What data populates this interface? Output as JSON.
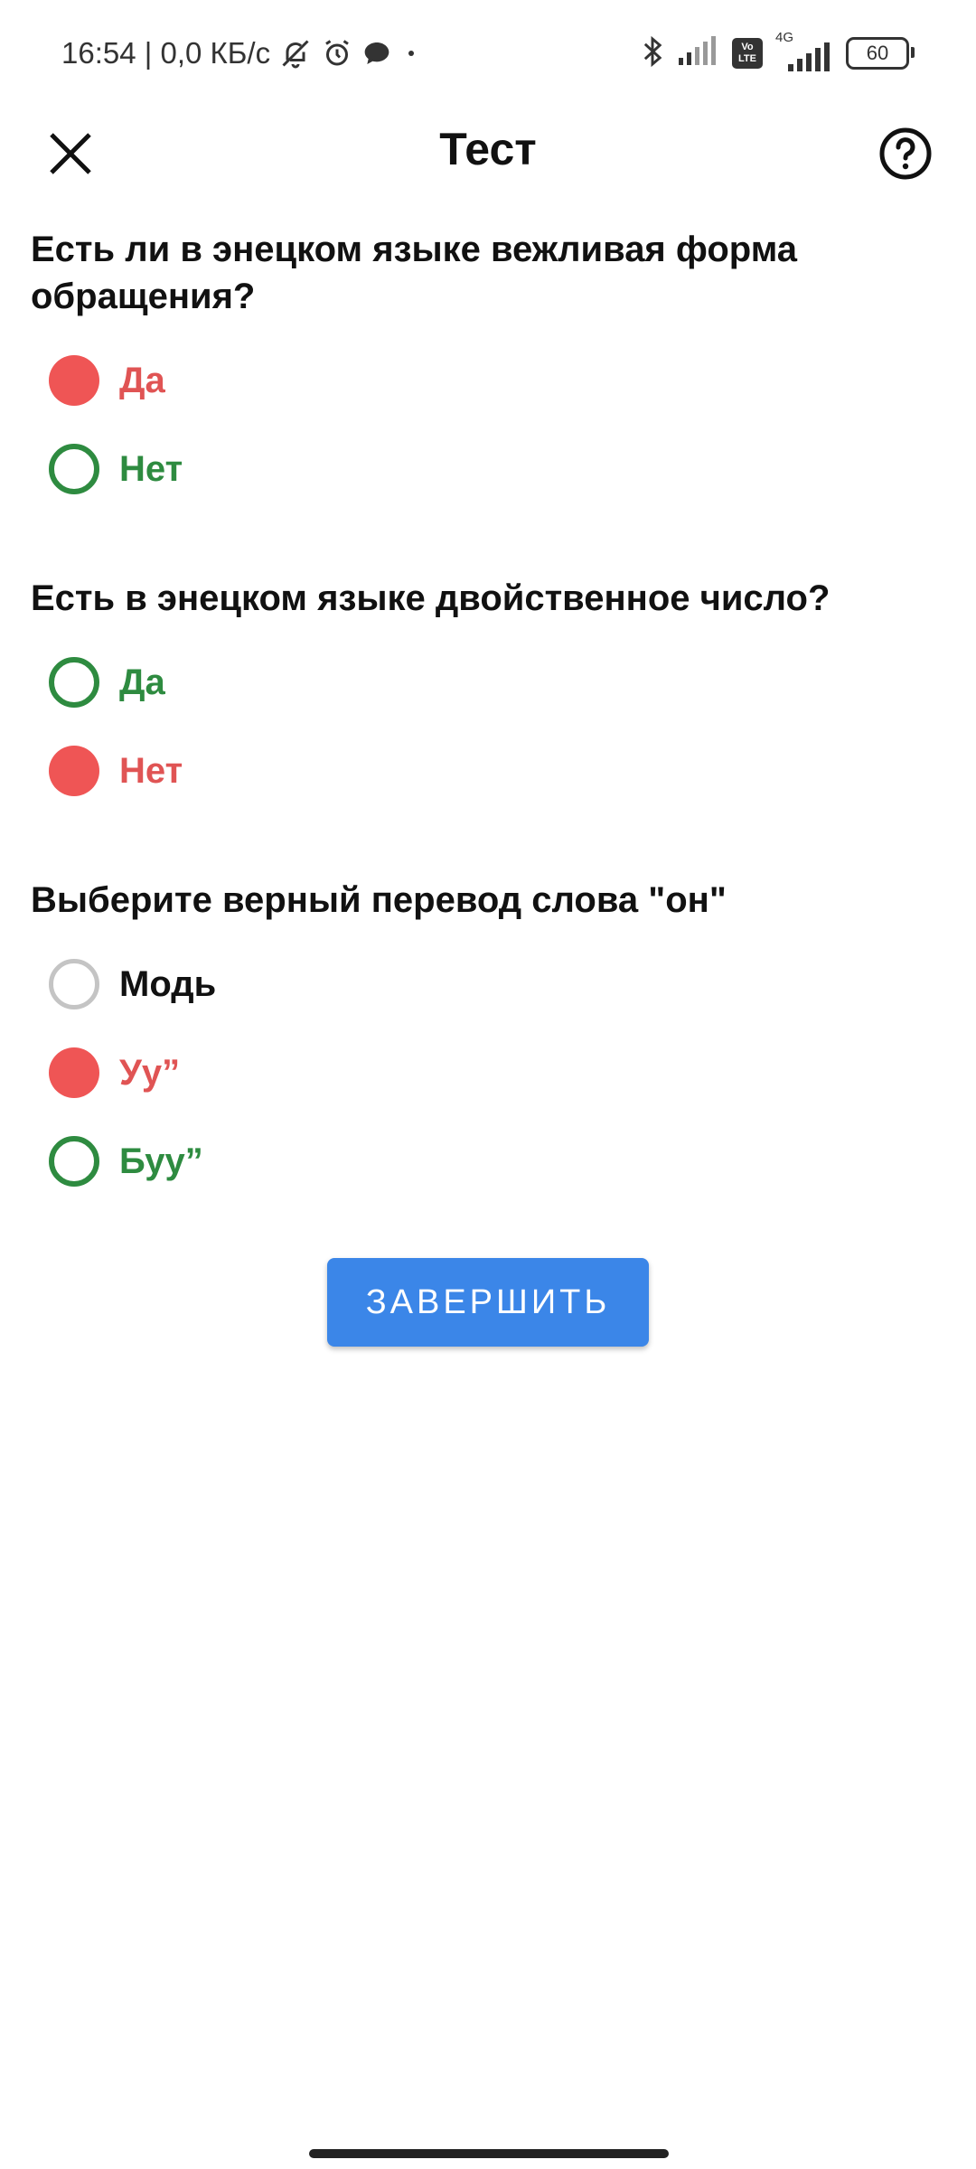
{
  "status_bar": {
    "time_speed": "16:54 | 0,0 КБ/с",
    "network_type": "4G",
    "volte": "Vo LTE",
    "battery": "60"
  },
  "header": {
    "title": "Тест"
  },
  "questions": [
    {
      "text": "Есть ли в энецком языке вежливая форма обращения?",
      "options": [
        {
          "label": "Да",
          "state": "wrong"
        },
        {
          "label": "Нет",
          "state": "correct"
        }
      ]
    },
    {
      "text": "Есть в энецком языке двойственное число?",
      "options": [
        {
          "label": "Да",
          "state": "correct"
        },
        {
          "label": "Нет",
          "state": "wrong"
        }
      ]
    },
    {
      "text": "Выберите верный перевод слова \"он\"",
      "options": [
        {
          "label": "Модь",
          "state": "neutral"
        },
        {
          "label": "Уу”",
          "state": "wrong"
        },
        {
          "label": "Буу”",
          "state": "correct"
        }
      ]
    }
  ],
  "finish_button": {
    "label": "ЗАВЕРШИТЬ"
  },
  "colors": {
    "correct": "#2e8b40",
    "wrong": "#ef5555",
    "accent": "#3b86e8"
  }
}
